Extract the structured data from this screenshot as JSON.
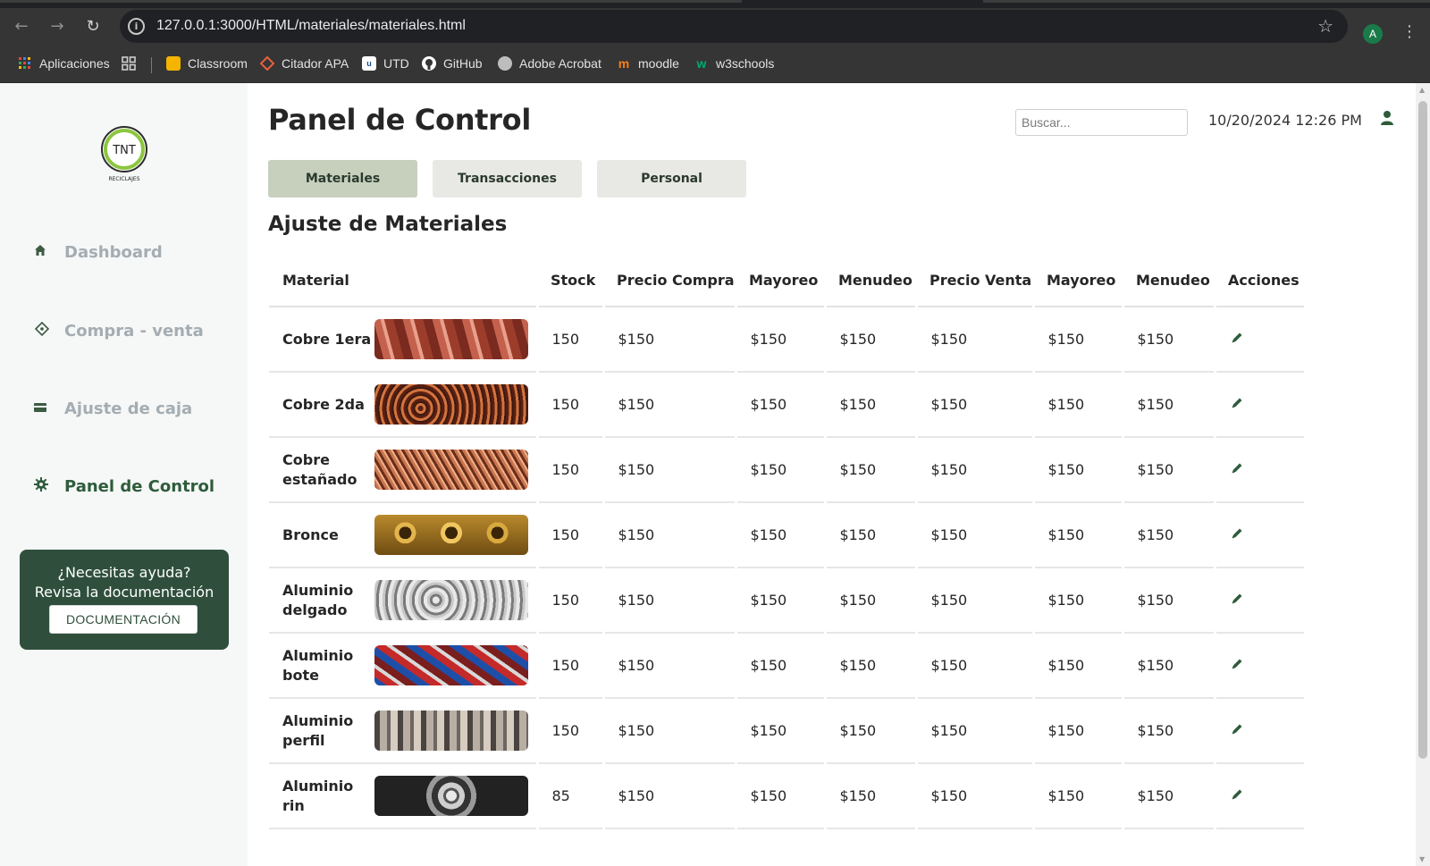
{
  "browser": {
    "url": "127.0.0.1:3000/HTML/materiales/materiales.html",
    "avatar_letter": "A",
    "bookmarks": [
      {
        "label": "Aplicaciones",
        "icon": "apps-grid-icon",
        "color": "#e8453c"
      },
      {
        "label": "",
        "icon": "tab-groups-icon",
        "color": "#bdbdbd"
      },
      {
        "label": "Classroom",
        "icon": "classroom-icon",
        "color": "#f4b400"
      },
      {
        "label": "Citador APA",
        "icon": "citador-icon",
        "color": "#e8603c"
      },
      {
        "label": "UTD",
        "icon": "utd-icon",
        "color": "#ffffff"
      },
      {
        "label": "GitHub",
        "icon": "github-icon",
        "color": "#ffffff"
      },
      {
        "label": "Adobe Acrobat",
        "icon": "acrobat-icon",
        "color": "#bdbdbd"
      },
      {
        "label": "moodle",
        "icon": "moodle-icon",
        "color": "#f98012"
      },
      {
        "label": "w3schools",
        "icon": "w3schools-icon",
        "color": "#04aa6d"
      }
    ]
  },
  "sidebar": {
    "logo_text": "TNT",
    "logo_sub": "RECICLAJES",
    "items": [
      {
        "label": "Dashboard",
        "icon": "home-icon",
        "active": false
      },
      {
        "label": "Compra - venta",
        "icon": "ticket-icon",
        "active": false
      },
      {
        "label": "Ajuste de caja",
        "icon": "cashbox-icon",
        "active": false
      },
      {
        "label": "Panel de Control",
        "icon": "gear-icon",
        "active": true
      }
    ],
    "help": {
      "line1": "¿Necesitas ayuda?",
      "line2": "Revisa la documentación",
      "button": "DOCUMENTACIÓN"
    }
  },
  "header": {
    "title": "Panel de Control",
    "search_placeholder": "Buscar...",
    "datetime": "10/20/2024 12:26 PM"
  },
  "tabs": [
    {
      "label": "Materiales",
      "active": true
    },
    {
      "label": "Transacciones",
      "active": false
    },
    {
      "label": "Personal",
      "active": false
    }
  ],
  "section_title": "Ajuste de Materiales",
  "table": {
    "columns": [
      "Material",
      "Stock",
      "Precio Compra",
      "Mayoreo",
      "Menudeo",
      "Precio Venta",
      "Mayoreo",
      "Menudeo",
      "Acciones"
    ],
    "rows": [
      {
        "material": "Cobre 1era",
        "thumb": "copper-rods",
        "stock": "150",
        "precio_compra": "$150",
        "mayoreo_c": "$150",
        "menudeo_c": "$150",
        "precio_venta": "$150",
        "mayoreo_v": "$150",
        "menudeo_v": "$150"
      },
      {
        "material": "Cobre 2da",
        "thumb": "copper-wire",
        "stock": "150",
        "precio_compra": "$150",
        "mayoreo_c": "$150",
        "menudeo_c": "$150",
        "precio_venta": "$150",
        "mayoreo_v": "$150",
        "menudeo_v": "$150"
      },
      {
        "material": "Cobre estañado",
        "thumb": "tinned-copper",
        "stock": "150",
        "precio_compra": "$150",
        "mayoreo_c": "$150",
        "menudeo_c": "$150",
        "precio_venta": "$150",
        "mayoreo_v": "$150",
        "menudeo_v": "$150"
      },
      {
        "material": "Bronce",
        "thumb": "bronze-rings",
        "stock": "150",
        "precio_compra": "$150",
        "mayoreo_c": "$150",
        "menudeo_c": "$150",
        "precio_venta": "$150",
        "mayoreo_v": "$150",
        "menudeo_v": "$150"
      },
      {
        "material": "Aluminio delgado",
        "thumb": "thin-aluminum",
        "stock": "150",
        "precio_compra": "$150",
        "mayoreo_c": "$150",
        "menudeo_c": "$150",
        "precio_venta": "$150",
        "mayoreo_v": "$150",
        "menudeo_v": "$150"
      },
      {
        "material": "Aluminio bote",
        "thumb": "aluminum-cans",
        "stock": "150",
        "precio_compra": "$150",
        "mayoreo_c": "$150",
        "menudeo_c": "$150",
        "precio_venta": "$150",
        "mayoreo_v": "$150",
        "menudeo_v": "$150"
      },
      {
        "material": "Aluminio perfil",
        "thumb": "aluminum-profile",
        "stock": "150",
        "precio_compra": "$150",
        "mayoreo_c": "$150",
        "menudeo_c": "$150",
        "precio_venta": "$150",
        "mayoreo_v": "$150",
        "menudeo_v": "$150"
      },
      {
        "material": "Aluminio rin",
        "thumb": "aluminum-rim",
        "stock": "85",
        "precio_compra": "$150",
        "mayoreo_c": "$150",
        "menudeo_c": "$150",
        "precio_venta": "$150",
        "mayoreo_v": "$150",
        "menudeo_v": "$150"
      }
    ]
  },
  "colors": {
    "accent": "#2f4f3c",
    "active_tab": "#c7d0bd",
    "inactive_tab": "#e8e8e5",
    "sidebar_bg": "#f6f7f7",
    "muted_nav": "#a4adb2"
  }
}
